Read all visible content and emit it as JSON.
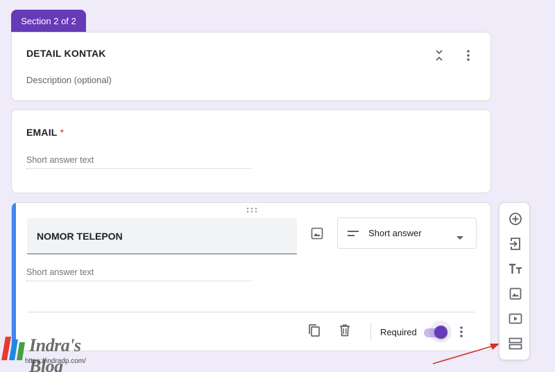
{
  "section": {
    "label": "Section 2 of 2"
  },
  "header_card": {
    "title": "DETAIL KONTAK",
    "description_placeholder": "Description (optional)"
  },
  "email_card": {
    "title": "EMAIL",
    "required_mark": "*",
    "answer_placeholder": "Short answer text"
  },
  "phone_card": {
    "question": "NOMOR TELEPON",
    "answer_placeholder": "Short answer text",
    "type_select": {
      "selected": "Short answer"
    },
    "required_label": "Required",
    "required_on": true
  },
  "toolbar": {
    "items": [
      {
        "icon": "add-question-icon"
      },
      {
        "icon": "import-questions-icon"
      },
      {
        "icon": "add-title-icon"
      },
      {
        "icon": "add-image-icon"
      },
      {
        "icon": "add-video-icon"
      },
      {
        "icon": "add-section-icon"
      }
    ]
  },
  "watermark": {
    "text": "Indra's Blog",
    "url": "https://indradp.com/"
  },
  "colors": {
    "accent": "#673ab7",
    "active_bar": "#4285f4",
    "background": "#efebf9",
    "required": "#d93025",
    "arrow": "#d32f2f"
  }
}
